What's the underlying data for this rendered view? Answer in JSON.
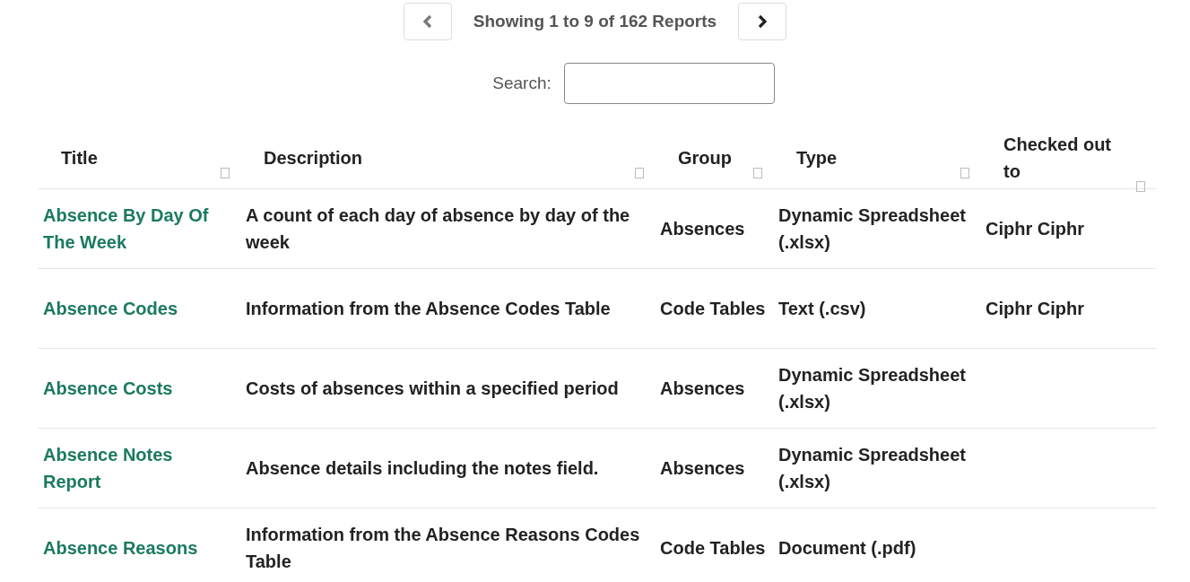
{
  "pager": {
    "prev": {
      "disabled": true
    },
    "next": {
      "disabled": false
    },
    "summary": "Showing 1 to 9 of 162 Reports"
  },
  "search": {
    "label": "Search:"
  },
  "table": {
    "columns": [
      {
        "label": "Title"
      },
      {
        "label": "Description"
      },
      {
        "label": "Group"
      },
      {
        "label": "Type"
      },
      {
        "label": "Checked out to"
      }
    ],
    "rows": [
      {
        "title": "Absence By Day Of The Week",
        "description": "A count of each day of absence by day of the week",
        "group": "Absences",
        "type": "Dynamic Spreadsheet (.xlsx)",
        "checked_out_to": "Ciphr Ciphr"
      },
      {
        "title": "Absence Codes",
        "description": "Information from the Absence Codes Table",
        "group": "Code Tables",
        "type": "Text (.csv)",
        "checked_out_to": "Ciphr Ciphr"
      },
      {
        "title": "Absence Costs",
        "description": "Costs of absences within a specified period",
        "group": "Absences",
        "type": "Dynamic Spreadsheet (.xlsx)"
      },
      {
        "title": "Absence Notes Report",
        "description": "Absence details including the notes field.",
        "group": "Absences",
        "type": "Dynamic Spreadsheet (.xlsx)"
      },
      {
        "title": "Absence Reasons",
        "description": "Information from the Absence Reasons Codes Table",
        "group": "Code Tables",
        "type": "Document (.pdf)"
      }
    ]
  }
}
